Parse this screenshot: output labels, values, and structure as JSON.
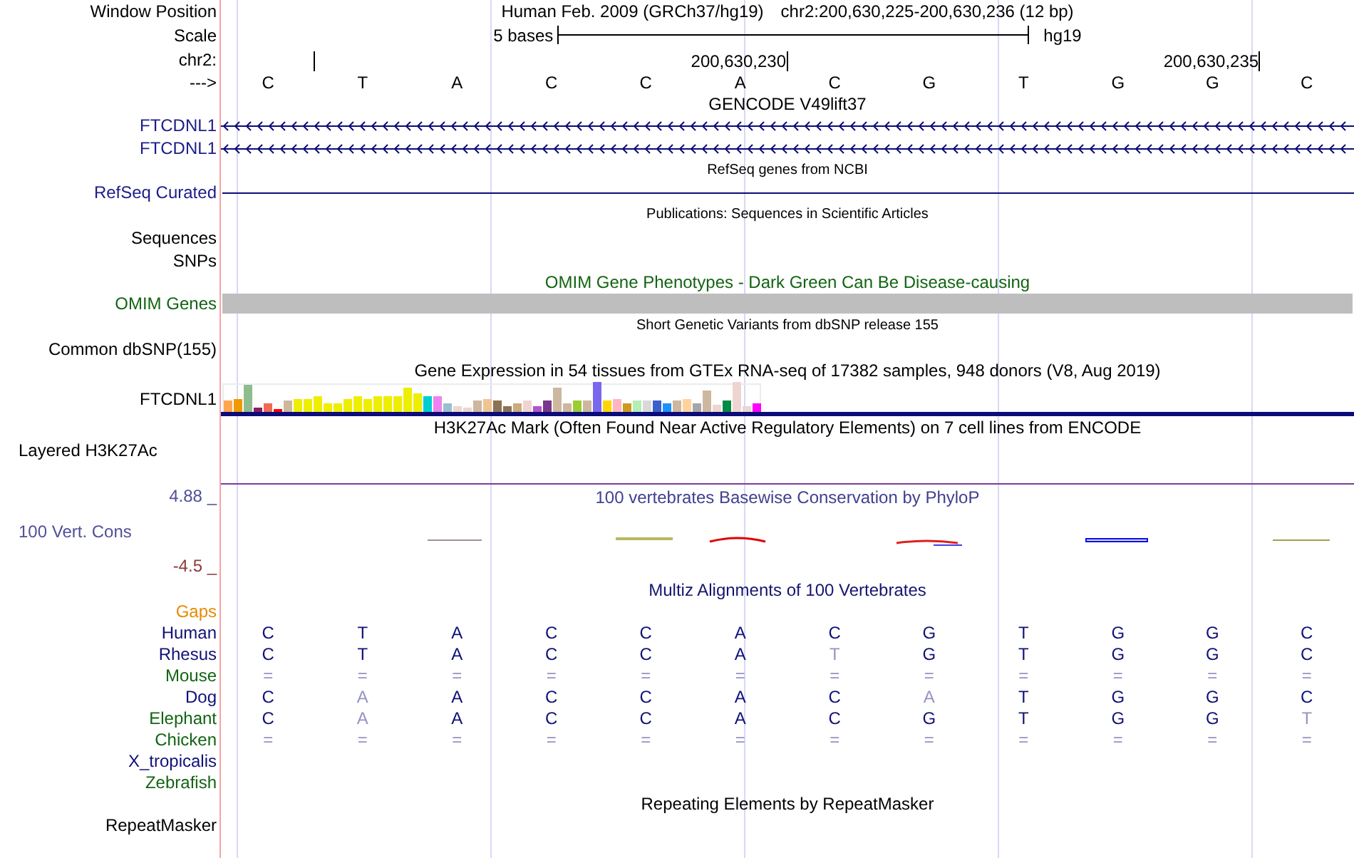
{
  "header": {
    "label": "Window Position",
    "assembly": "Human Feb. 2009 (GRCh37/hg19)",
    "position": "chr2:200,630,225-200,630,236 (12 bp)"
  },
  "scale": {
    "label": "Scale",
    "size": "5 bases",
    "assembly": "hg19"
  },
  "ruler": {
    "label": "chr2:",
    "tick_labels": [
      "200,630,230",
      "200,630,235"
    ]
  },
  "sequence": {
    "label": "--->",
    "bases": [
      "C",
      "T",
      "A",
      "C",
      "C",
      "A",
      "C",
      "G",
      "T",
      "G",
      "G",
      "C"
    ]
  },
  "tracks": [
    {
      "kind": "gencode",
      "title": "GENCODE V49lift37",
      "genes": [
        "FTCDNL1",
        "FTCDNL1"
      ]
    },
    {
      "kind": "refseq",
      "title": "RefSeq genes from NCBI",
      "label": "RefSeq Curated"
    },
    {
      "kind": "publications",
      "title": "Publications: Sequences in Scientific Articles",
      "labels": [
        "Sequences",
        "SNPs"
      ]
    },
    {
      "kind": "omim",
      "title": "OMIM Gene Phenotypes - Dark Green Can Be Disease-causing",
      "label": "OMIM Genes"
    },
    {
      "kind": "dbsnp",
      "title": "Short Genetic Variants from dbSNP release 155",
      "label": "Common dbSNP(155)"
    },
    {
      "kind": "gtex",
      "title": "Gene Expression in 54 tissues from GTEx RNA-seq of 17382 samples, 948 donors (V8, Aug 2019)",
      "label": "FTCDNL1"
    },
    {
      "kind": "h3k27ac",
      "title": "H3K27Ac Mark (Often Found Near Active Regulatory Elements) on 7 cell lines from ENCODE",
      "label": "Layered H3K27Ac"
    },
    {
      "kind": "phylop",
      "title": "100 vertebrates Basewise Conservation by PhyloP",
      "label": "100 Vert. Cons",
      "max": "4.88 _",
      "min": "-4.5 _"
    },
    {
      "kind": "multiz",
      "title": "Multiz Alignments of 100 Vertebrates",
      "gaps_label": "Gaps",
      "species": [
        {
          "name": "Human",
          "color": "#101078",
          "bases": [
            {
              "base": "C",
              "faded": false
            },
            {
              "base": "T",
              "faded": false
            },
            {
              "base": "A",
              "faded": false
            },
            {
              "base": "C",
              "faded": false
            },
            {
              "base": "C",
              "faded": false
            },
            {
              "base": "A",
              "faded": false
            },
            {
              "base": "C",
              "faded": false
            },
            {
              "base": "G",
              "faded": false
            },
            {
              "base": "T",
              "faded": false
            },
            {
              "base": "G",
              "faded": false
            },
            {
              "base": "G",
              "faded": false
            },
            {
              "base": "C",
              "faded": false
            }
          ]
        },
        {
          "name": "Rhesus",
          "color": "#101078",
          "bases": [
            {
              "base": "C",
              "faded": false
            },
            {
              "base": "T",
              "faded": false
            },
            {
              "base": "A",
              "faded": false
            },
            {
              "base": "C",
              "faded": false
            },
            {
              "base": "C",
              "faded": false
            },
            {
              "base": "A",
              "faded": false
            },
            {
              "base": "T",
              "faded": true
            },
            {
              "base": "G",
              "faded": false
            },
            {
              "base": "T",
              "faded": false
            },
            {
              "base": "G",
              "faded": false
            },
            {
              "base": "G",
              "faded": false
            },
            {
              "base": "C",
              "faded": false
            }
          ]
        },
        {
          "name": "Mouse",
          "color": "#126412",
          "bases": [
            {
              "base": "=",
              "faded": true
            },
            {
              "base": "=",
              "faded": true
            },
            {
              "base": "=",
              "faded": true
            },
            {
              "base": "=",
              "faded": true
            },
            {
              "base": "=",
              "faded": true
            },
            {
              "base": "=",
              "faded": true
            },
            {
              "base": "=",
              "faded": true
            },
            {
              "base": "=",
              "faded": true
            },
            {
              "base": "=",
              "faded": true
            },
            {
              "base": "=",
              "faded": true
            },
            {
              "base": "=",
              "faded": true
            },
            {
              "base": "=",
              "faded": true
            }
          ]
        },
        {
          "name": "Dog",
          "color": "#101078",
          "bases": [
            {
              "base": "C",
              "faded": false
            },
            {
              "base": "A",
              "faded": true
            },
            {
              "base": "A",
              "faded": false
            },
            {
              "base": "C",
              "faded": false
            },
            {
              "base": "C",
              "faded": false
            },
            {
              "base": "A",
              "faded": false
            },
            {
              "base": "C",
              "faded": false
            },
            {
              "base": "A",
              "faded": true
            },
            {
              "base": "T",
              "faded": false
            },
            {
              "base": "G",
              "faded": false
            },
            {
              "base": "G",
              "faded": false
            },
            {
              "base": "C",
              "faded": false
            }
          ]
        },
        {
          "name": "Elephant",
          "color": "#126412",
          "bases": [
            {
              "base": "C",
              "faded": false
            },
            {
              "base": "A",
              "faded": true
            },
            {
              "base": "A",
              "faded": false
            },
            {
              "base": "C",
              "faded": false
            },
            {
              "base": "C",
              "faded": false
            },
            {
              "base": "A",
              "faded": false
            },
            {
              "base": "C",
              "faded": false
            },
            {
              "base": "G",
              "faded": false
            },
            {
              "base": "T",
              "faded": false
            },
            {
              "base": "G",
              "faded": false
            },
            {
              "base": "G",
              "faded": false
            },
            {
              "base": "T",
              "faded": true
            }
          ]
        },
        {
          "name": "Chicken",
          "color": "#126412",
          "bases": [
            {
              "base": "=",
              "faded": true
            },
            {
              "base": "=",
              "faded": true
            },
            {
              "base": "=",
              "faded": true
            },
            {
              "base": "=",
              "faded": true
            },
            {
              "base": "=",
              "faded": true
            },
            {
              "base": "=",
              "faded": true
            },
            {
              "base": "=",
              "faded": true
            },
            {
              "base": "=",
              "faded": true
            },
            {
              "base": "=",
              "faded": true
            },
            {
              "base": "=",
              "faded": true
            },
            {
              "base": "=",
              "faded": true
            },
            {
              "base": "=",
              "faded": true
            }
          ]
        },
        {
          "name": "X_tropicalis",
          "color": "#101078"
        },
        {
          "name": "Zebrafish",
          "color": "#126412"
        }
      ]
    },
    {
      "kind": "repeatmasker",
      "title": "Repeating Elements by RepeatMasker",
      "label": "RepeatMasker"
    }
  ]
}
